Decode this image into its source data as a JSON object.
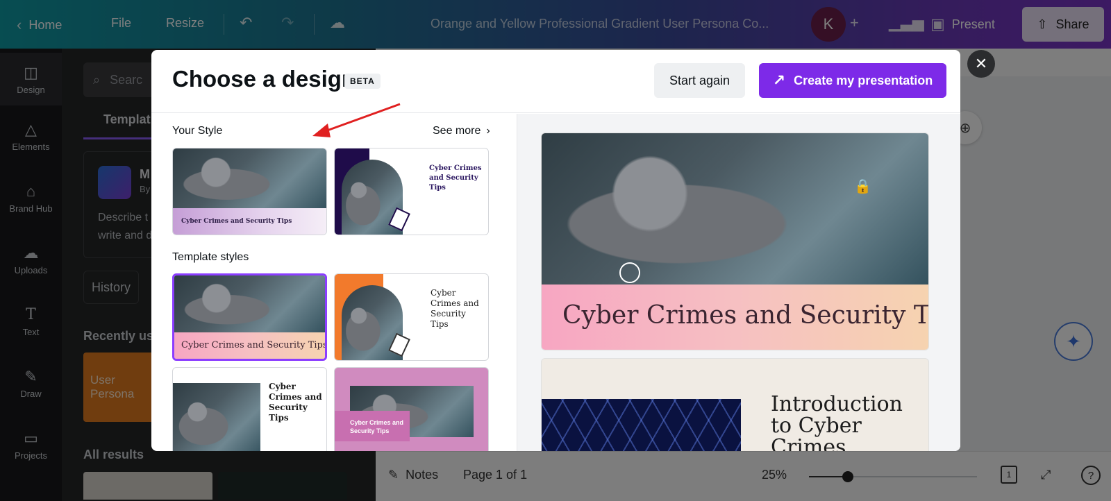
{
  "topbar": {
    "home": "Home",
    "file": "File",
    "resize": "Resize",
    "doc_title": "Orange and Yellow Professional Gradient User Persona Co...",
    "avatar_letter": "K",
    "present": "Present",
    "share": "Share"
  },
  "rail": {
    "items": [
      {
        "label": "Design",
        "icon": "layout-icon"
      },
      {
        "label": "Elements",
        "icon": "shapes-icon"
      },
      {
        "label": "Brand Hub",
        "icon": "brand-icon"
      },
      {
        "label": "Uploads",
        "icon": "cloud-upload-icon"
      },
      {
        "label": "Text",
        "icon": "text-icon"
      },
      {
        "label": "Draw",
        "icon": "pen-icon"
      },
      {
        "label": "Projects",
        "icon": "folder-icon"
      }
    ]
  },
  "panel": {
    "search_placeholder": "Searc",
    "tab": "Templat",
    "card_title": "M",
    "card_sub": "By",
    "card_line1": "Describe t",
    "card_line2": "write and d",
    "history": "History",
    "recently_used": "Recently us",
    "recent_thumb_text": "User Persona",
    "all_results": "All results"
  },
  "modal": {
    "title": "Choose a design",
    "beta": "BETA",
    "start_again": "Start again",
    "create": "Create my presentation",
    "your_style": "Your Style",
    "see_more": "See more",
    "template_styles": "Template styles",
    "tiles": {
      "ys1": "Cyber Crimes and Security Tips",
      "ys2": "Cyber Crimes and Security Tips",
      "ts1": "Cyber Crimes and Security Tips",
      "ts2": "Cyber Crimes and Security Tips",
      "ts3": "Cyber Crimes and Security Tips",
      "ts4": "Cyber Crimes and Security Tips"
    },
    "preview_title": "Cyber Crimes and Security Tips",
    "preview2_title": "Introduction to Cyber Crimes"
  },
  "bottombar": {
    "notes": "Notes",
    "page": "Page 1 of 1",
    "zoom": "25%",
    "zoom_level": 0.23,
    "page_count_badge": "1",
    "help": "?"
  },
  "colors": {
    "accent": "#7d2ae8",
    "selected_border": "#8b3dff",
    "annotation_arrow": "#e02020"
  }
}
